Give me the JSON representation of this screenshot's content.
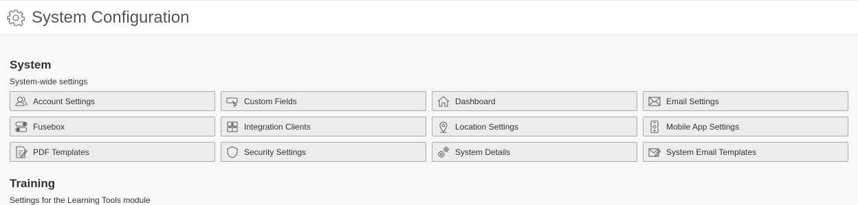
{
  "page": {
    "title": "System Configuration",
    "title_icon": "gear-icon"
  },
  "system": {
    "heading": "System",
    "description": "System-wide settings",
    "tiles": [
      {
        "label": "Account Settings",
        "icon": "users-icon"
      },
      {
        "label": "Custom Fields",
        "icon": "custom-fields-icon"
      },
      {
        "label": "Dashboard",
        "icon": "home-icon"
      },
      {
        "label": "Email Settings",
        "icon": "envelope-icon"
      },
      {
        "label": "Fusebox",
        "icon": "toggle-icon"
      },
      {
        "label": "Integration Clients",
        "icon": "puzzle-icon"
      },
      {
        "label": "Location Settings",
        "icon": "map-pin-icon"
      },
      {
        "label": "Mobile App Settings",
        "icon": "mobile-phone-icon"
      },
      {
        "label": "PDF Templates",
        "icon": "document-edit-icon"
      },
      {
        "label": "Security Settings",
        "icon": "shield-icon"
      },
      {
        "label": "System Details",
        "icon": "gears-icon"
      },
      {
        "label": "System Email Templates",
        "icon": "email-edit-icon"
      }
    ]
  },
  "training": {
    "heading": "Training",
    "description": "Settings for the Learning Tools module"
  }
}
